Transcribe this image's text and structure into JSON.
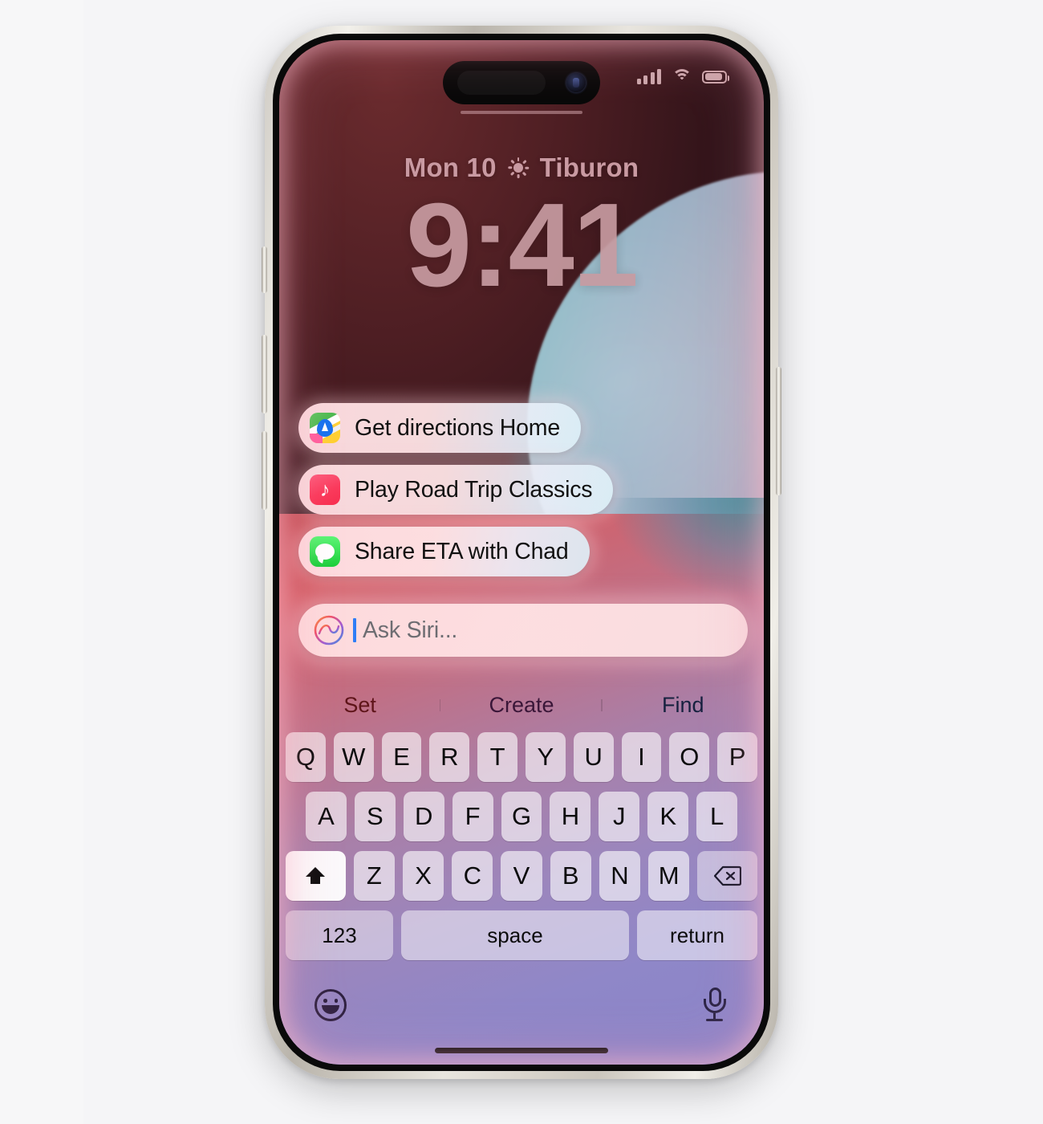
{
  "device": {
    "name": "iPhone",
    "buttons": {
      "action": "action-button",
      "volume_up": "volume-up-button",
      "volume_down": "volume-down-button",
      "power": "power-button"
    }
  },
  "status_bar": {
    "cellular_icon": "cellular-bars-icon",
    "cellular_bars": 4,
    "wifi_icon": "wifi-icon",
    "battery_icon": "battery-icon",
    "battery_level": "80"
  },
  "lock_screen": {
    "date": "Mon 10",
    "weather_icon": "sun-icon",
    "location": "Tiburon",
    "time": "9:41"
  },
  "siri": {
    "suggestions": [
      {
        "icon": "maps-app-icon",
        "label": "Get directions Home"
      },
      {
        "icon": "music-app-icon",
        "label": "Play Road Trip Classics"
      },
      {
        "icon": "messages-app-icon",
        "label": "Share ETA with Chad"
      }
    ],
    "input": {
      "icon": "siri-orb-icon",
      "placeholder": "Ask Siri...",
      "value": "",
      "caret_color": "#2f7df6"
    }
  },
  "keyboard": {
    "predictions": [
      "Set",
      "Create",
      "Find"
    ],
    "row1": [
      "Q",
      "W",
      "E",
      "R",
      "T",
      "Y",
      "U",
      "I",
      "O",
      "P"
    ],
    "row2": [
      "A",
      "S",
      "D",
      "F",
      "G",
      "H",
      "J",
      "K",
      "L"
    ],
    "row3": [
      "Z",
      "X",
      "C",
      "V",
      "B",
      "N",
      "M"
    ],
    "shift_icon": "shift-key-icon",
    "backspace_icon": "backspace-key-icon",
    "numbers_key": "123",
    "space_key": "space",
    "return_key": "return",
    "emoji_icon": "emoji-key-icon",
    "dictation_icon": "microphone-key-icon"
  },
  "colors": {
    "accent_pink": "#ffdee2",
    "siri_blue": "#2f7df6",
    "maps_green": "#49b84d",
    "music_red": "#fa3a5c",
    "messages_green": "#19cf3a",
    "clock_pink": "#c79ba1"
  }
}
